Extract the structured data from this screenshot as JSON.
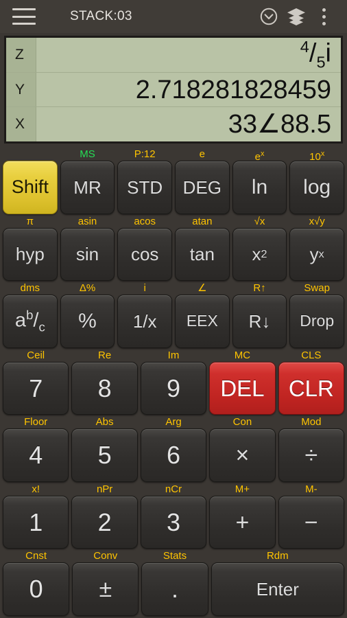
{
  "topbar": {
    "title": "STACK:03",
    "menu_icon": "hamburger-icon",
    "history_icon": "clock-history-icon",
    "stack_icon": "layers-icon",
    "overflow_icon": "more-vert-icon"
  },
  "display": {
    "registers": [
      {
        "name": "Z",
        "value": "4/5i",
        "value_kind": "fraction",
        "numerator": "4",
        "slash": "/",
        "denominator": "5",
        "suffix": "i"
      },
      {
        "name": "Y",
        "value": "2.718281828459",
        "value_kind": "plain"
      },
      {
        "name": "X",
        "value": "33∠88.5",
        "value_kind": "plain"
      }
    ]
  },
  "colors": {
    "background": "#3b3733",
    "display_bg": "#b9c3a6",
    "display_label_bg": "#a8b394",
    "shift_yellow": "#e8cf3e",
    "danger_red": "#c62a27",
    "shift_label_gold": "#ffc400",
    "memory_green": "#25dd55",
    "key_text": "#dcdcdc"
  },
  "keypad": {
    "rows": [
      {
        "columns": 6,
        "keys": [
          {
            "label": "Shift",
            "shift": "",
            "style": "shift",
            "name": "shift-key"
          },
          {
            "label": "MR",
            "shift": "MS",
            "style": "small",
            "name": "memory-recall-key",
            "shift_color": "green"
          },
          {
            "label": "STD",
            "shift": "P:12",
            "style": "small",
            "name": "number-format-key"
          },
          {
            "label": "DEG",
            "shift": "e",
            "style": "small",
            "name": "angle-mode-key"
          },
          {
            "label": "ln",
            "shift": "e^x",
            "style": "",
            "name": "ln-key"
          },
          {
            "label": "log",
            "shift": "10^x",
            "style": "",
            "name": "log-key"
          }
        ]
      },
      {
        "columns": 6,
        "keys": [
          {
            "label": "hyp",
            "shift": "π",
            "style": "small",
            "name": "hyp-key"
          },
          {
            "label": "sin",
            "shift": "asin",
            "style": "small",
            "name": "sin-key"
          },
          {
            "label": "cos",
            "shift": "acos",
            "style": "small",
            "name": "cos-key"
          },
          {
            "label": "tan",
            "shift": "atan",
            "style": "small",
            "name": "tan-key"
          },
          {
            "label": "x^2",
            "shift": "√x",
            "style": "small",
            "name": "square-key"
          },
          {
            "label": "y^x",
            "shift": "x√y",
            "style": "small",
            "name": "power-key"
          }
        ]
      },
      {
        "columns": 6,
        "keys": [
          {
            "label": "a b/c",
            "shift": "dms",
            "style": "abc",
            "name": "fraction-key"
          },
          {
            "label": "%",
            "shift": "Δ%",
            "style": "",
            "name": "percent-key"
          },
          {
            "label": "1/x",
            "shift": "i",
            "style": "small",
            "name": "reciprocal-key"
          },
          {
            "label": "EEX",
            "shift": "∠",
            "style": "xsmall",
            "name": "exponent-key"
          },
          {
            "label": "R↓",
            "shift": "R↑",
            "style": "small",
            "name": "roll-down-key"
          },
          {
            "label": "Drop",
            "shift": "Swap",
            "style": "xsmall",
            "name": "drop-key"
          }
        ]
      },
      {
        "columns": 5,
        "keys": [
          {
            "label": "7",
            "shift": "Ceil",
            "style": "num",
            "name": "digit-7-key"
          },
          {
            "label": "8",
            "shift": "Re",
            "style": "num",
            "name": "digit-8-key"
          },
          {
            "label": "9",
            "shift": "Im",
            "style": "num",
            "name": "digit-9-key"
          },
          {
            "label": "DEL",
            "shift": "MC",
            "style": "danger",
            "name": "delete-key"
          },
          {
            "label": "CLR",
            "shift": "CLS",
            "style": "danger",
            "name": "clear-key"
          }
        ]
      },
      {
        "columns": 5,
        "keys": [
          {
            "label": "4",
            "shift": "Floor",
            "style": "num",
            "name": "digit-4-key"
          },
          {
            "label": "5",
            "shift": "Abs",
            "style": "num",
            "name": "digit-5-key"
          },
          {
            "label": "6",
            "shift": "Arg",
            "style": "num",
            "name": "digit-6-key"
          },
          {
            "label": "×",
            "shift": "Con",
            "style": "op",
            "name": "multiply-key"
          },
          {
            "label": "÷",
            "shift": "Mod",
            "style": "op",
            "name": "divide-key"
          }
        ]
      },
      {
        "columns": 5,
        "keys": [
          {
            "label": "1",
            "shift": "x!",
            "style": "num",
            "name": "digit-1-key"
          },
          {
            "label": "2",
            "shift": "nPr",
            "style": "num",
            "name": "digit-2-key"
          },
          {
            "label": "3",
            "shift": "nCr",
            "style": "num",
            "name": "digit-3-key"
          },
          {
            "label": "+",
            "shift": "M+",
            "style": "op",
            "name": "add-key"
          },
          {
            "label": "−",
            "shift": "M-",
            "style": "op",
            "name": "subtract-key"
          }
        ]
      },
      {
        "columns": 5,
        "keys": [
          {
            "label": "0",
            "shift": "Cnst",
            "style": "num",
            "name": "digit-0-key"
          },
          {
            "label": "±",
            "shift": "Conv",
            "style": "op",
            "name": "sign-key"
          },
          {
            "label": ".",
            "shift": "Stats",
            "style": "num",
            "name": "decimal-point-key"
          },
          {
            "label": "Enter",
            "shift": "Rdm",
            "style": "small",
            "name": "enter-key",
            "span": 2
          }
        ]
      }
    ]
  }
}
